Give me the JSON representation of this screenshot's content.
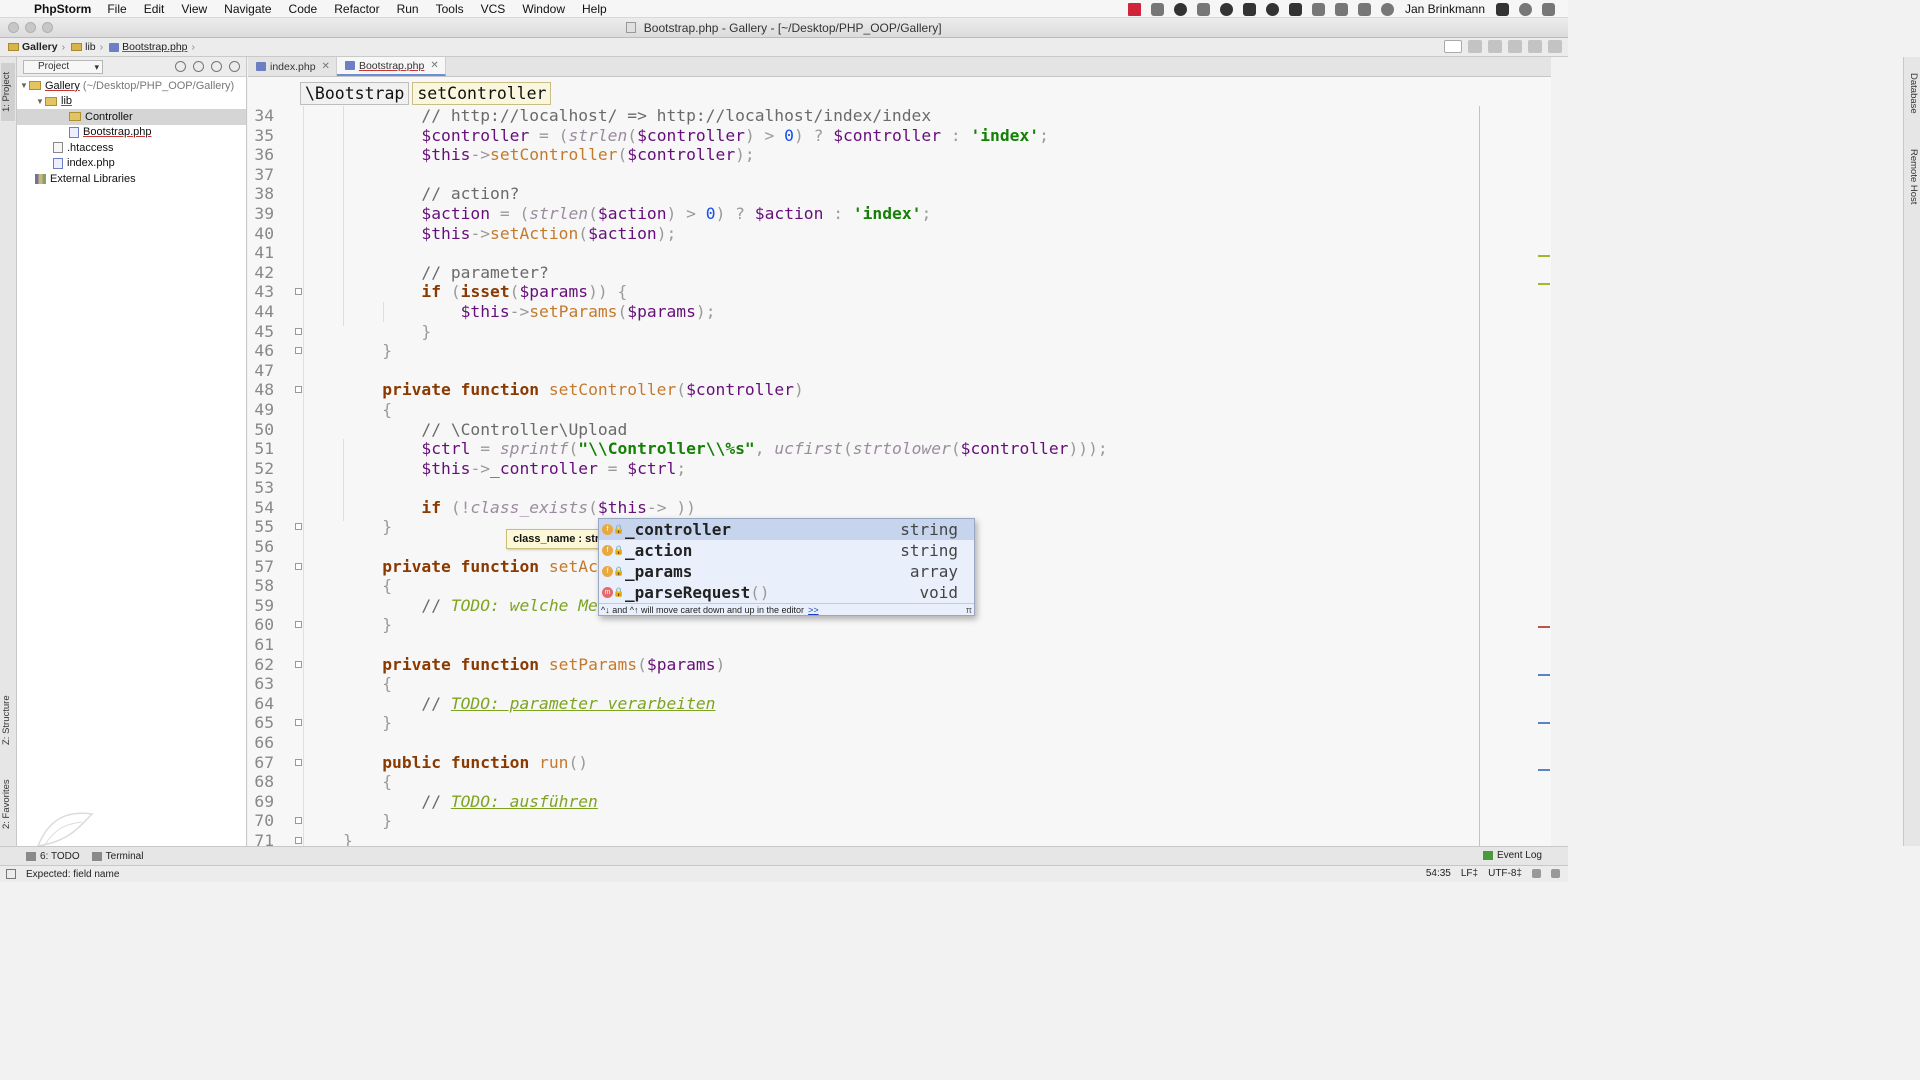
{
  "menubar": {
    "apple": "",
    "app_name": "PhpStorm",
    "items": [
      "File",
      "Edit",
      "View",
      "Navigate",
      "Code",
      "Refactor",
      "Run",
      "Tools",
      "VCS",
      "Window",
      "Help"
    ],
    "user": "Jan Brinkmann"
  },
  "window": {
    "title": "Bootstrap.php - Gallery - [~/Desktop/PHP_OOP/Gallery]"
  },
  "navbar": {
    "crumbs": [
      "Gallery",
      "lib",
      "Bootstrap.php"
    ]
  },
  "left_stripe": {
    "project_tab": "1: Project",
    "structure_tab": "Z: Structure",
    "favorites_tab": "2: Favorites"
  },
  "right_stripe": {
    "database_tab": "Database",
    "remote_host_tab": "Remote Host"
  },
  "project_panel": {
    "view_label": "Project",
    "tree": {
      "root": "Gallery",
      "root_path": "(~/Desktop/PHP_OOP/Gallery)",
      "lib": "lib",
      "controller": "Controller",
      "bootstrap": "Bootstrap.php",
      "htaccess": ".htaccess",
      "index": "index.php",
      "external": "External Libraries"
    }
  },
  "editor_tabs": [
    {
      "label": "index.php",
      "active": false
    },
    {
      "label": "Bootstrap.php",
      "active": true
    }
  ],
  "editor": {
    "breadcrumb": [
      "\\Bootstrap",
      "setController"
    ],
    "param_hint": "class_name : str",
    "lines": [
      {
        "n": "34",
        "segs": [
          [
            "cm",
            "        // http://localhost/ => http://localhost/index/index"
          ]
        ]
      },
      {
        "n": "35",
        "segs": [
          [
            "var",
            "        $controller"
          ],
          [
            "pn",
            " = ("
          ],
          [
            "bfn",
            "strlen"
          ],
          [
            "pn",
            "("
          ],
          [
            "var",
            "$controller"
          ],
          [
            "pn",
            ") > "
          ],
          [
            "num",
            "0"
          ],
          [
            "pn",
            ") ? "
          ],
          [
            "var",
            "$controller"
          ],
          [
            "pn",
            " : "
          ],
          [
            "str",
            "'index'"
          ],
          [
            "pn",
            ";"
          ]
        ]
      },
      {
        "n": "36",
        "segs": [
          [
            "var",
            "        $this"
          ],
          [
            "pn",
            "->"
          ],
          [
            "fn",
            "setController"
          ],
          [
            "pn",
            "("
          ],
          [
            "var",
            "$controller"
          ],
          [
            "pn",
            ");"
          ]
        ]
      },
      {
        "n": "37",
        "segs": []
      },
      {
        "n": "38",
        "segs": [
          [
            "cm",
            "        // action?"
          ]
        ]
      },
      {
        "n": "39",
        "segs": [
          [
            "var",
            "        $action"
          ],
          [
            "pn",
            " = ("
          ],
          [
            "bfn",
            "strlen"
          ],
          [
            "pn",
            "("
          ],
          [
            "var",
            "$action"
          ],
          [
            "pn",
            ") > "
          ],
          [
            "num",
            "0"
          ],
          [
            "pn",
            ") ? "
          ],
          [
            "var",
            "$action"
          ],
          [
            "pn",
            " : "
          ],
          [
            "str",
            "'index'"
          ],
          [
            "pn",
            ";"
          ]
        ]
      },
      {
        "n": "40",
        "segs": [
          [
            "var",
            "        $this"
          ],
          [
            "pn",
            "->"
          ],
          [
            "fn",
            "setAction"
          ],
          [
            "pn",
            "("
          ],
          [
            "var",
            "$action"
          ],
          [
            "pn",
            ");"
          ]
        ]
      },
      {
        "n": "41",
        "segs": []
      },
      {
        "n": "42",
        "segs": [
          [
            "cm",
            "        // parameter?"
          ]
        ]
      },
      {
        "n": "43",
        "segs": [
          [
            "kw",
            "        if"
          ],
          [
            "pn",
            " ("
          ],
          [
            "kw",
            "isset"
          ],
          [
            "pn",
            "("
          ],
          [
            "var",
            "$params"
          ],
          [
            "pn",
            ")) {"
          ]
        ]
      },
      {
        "n": "44",
        "segs": [
          [
            "var",
            "            $this"
          ],
          [
            "pn",
            "->"
          ],
          [
            "fn",
            "setParams"
          ],
          [
            "pn",
            "("
          ],
          [
            "var",
            "$params"
          ],
          [
            "pn",
            ");"
          ]
        ]
      },
      {
        "n": "45",
        "segs": [
          [
            "pn",
            "        }"
          ]
        ]
      },
      {
        "n": "46",
        "segs": [
          [
            "pn",
            "    }"
          ]
        ]
      },
      {
        "n": "47",
        "segs": []
      },
      {
        "n": "48",
        "segs": [
          [
            "kw",
            "    private function "
          ],
          [
            "fn",
            "setController"
          ],
          [
            "pn",
            "("
          ],
          [
            "var",
            "$controller"
          ],
          [
            "pn",
            ")"
          ]
        ]
      },
      {
        "n": "49",
        "segs": [
          [
            "pn",
            "    {"
          ]
        ]
      },
      {
        "n": "50",
        "segs": [
          [
            "cm",
            "        // \\Controller\\Upload"
          ]
        ]
      },
      {
        "n": "51",
        "segs": [
          [
            "var",
            "        $ctrl"
          ],
          [
            "pn",
            " = "
          ],
          [
            "bfn",
            "sprintf"
          ],
          [
            "pn",
            "("
          ],
          [
            "str",
            "\"\\\\Controller\\\\%s\""
          ],
          [
            "pn",
            ", "
          ],
          [
            "bfn",
            "ucfirst"
          ],
          [
            "pn",
            "("
          ],
          [
            "bfn",
            "strtolower"
          ],
          [
            "pn",
            "("
          ],
          [
            "var",
            "$controller"
          ],
          [
            "pn",
            ")));"
          ]
        ]
      },
      {
        "n": "52",
        "segs": [
          [
            "var",
            "        $this"
          ],
          [
            "pn",
            "->"
          ],
          [
            "var",
            "_controller"
          ],
          [
            "pn",
            " = "
          ],
          [
            "var",
            "$ctrl"
          ],
          [
            "pn",
            ";"
          ]
        ]
      },
      {
        "n": "53",
        "segs": []
      },
      {
        "n": "54",
        "segs": [
          [
            "kw",
            "        if"
          ],
          [
            "pn",
            " (!"
          ],
          [
            "bfn",
            "class_exists"
          ],
          [
            "pn",
            "("
          ],
          [
            "var",
            "$this"
          ],
          [
            "pn",
            "-> ))"
          ]
        ]
      },
      {
        "n": "55",
        "segs": [
          [
            "pn",
            "    }"
          ]
        ]
      },
      {
        "n": "56",
        "segs": []
      },
      {
        "n": "57",
        "segs": [
          [
            "kw",
            "    private function "
          ],
          [
            "fn",
            "setAction"
          ]
        ]
      },
      {
        "n": "58",
        "segs": [
          [
            "pn",
            "    {"
          ]
        ]
      },
      {
        "n": "59",
        "segs": [
          [
            "cm",
            "        // "
          ],
          [
            "todo",
            "TODO: welche Method"
          ]
        ]
      },
      {
        "n": "60",
        "segs": [
          [
            "pn",
            "    }"
          ]
        ]
      },
      {
        "n": "61",
        "segs": []
      },
      {
        "n": "62",
        "segs": [
          [
            "kw",
            "    private function "
          ],
          [
            "fn",
            "setParams"
          ],
          [
            "pn",
            "("
          ],
          [
            "var",
            "$params"
          ],
          [
            "pn",
            ")"
          ]
        ]
      },
      {
        "n": "63",
        "segs": [
          [
            "pn",
            "    {"
          ]
        ]
      },
      {
        "n": "64",
        "segs": [
          [
            "cm",
            "        // "
          ],
          [
            "todo",
            "TODO: parameter verarbeiten"
          ]
        ]
      },
      {
        "n": "65",
        "segs": [
          [
            "pn",
            "    }"
          ]
        ]
      },
      {
        "n": "66",
        "segs": []
      },
      {
        "n": "67",
        "segs": [
          [
            "kw",
            "    public function "
          ],
          [
            "fn",
            "run"
          ],
          [
            "pn",
            "()"
          ]
        ]
      },
      {
        "n": "68",
        "segs": [
          [
            "pn",
            "    {"
          ]
        ]
      },
      {
        "n": "69",
        "segs": [
          [
            "cm",
            "        // "
          ],
          [
            "todo",
            "TODO: ausführen"
          ]
        ]
      },
      {
        "n": "70",
        "segs": [
          [
            "pn",
            "    }"
          ]
        ]
      },
      {
        "n": "71",
        "segs": [
          [
            "pn",
            "}"
          ]
        ]
      }
    ]
  },
  "completion": {
    "items": [
      {
        "name": "_controller",
        "type": "string",
        "kind": "field",
        "selected": true
      },
      {
        "name": "_action",
        "type": "string",
        "kind": "field",
        "selected": false
      },
      {
        "name": "_params",
        "type": "array",
        "kind": "field",
        "selected": false
      },
      {
        "name": "_parseRequest",
        "suffix": "()",
        "type": "void",
        "kind": "method",
        "selected": false
      }
    ],
    "footer": "^↓ and ^↑ will move caret down and up in the editor",
    "footer_link": ">>",
    "footer_pi": "π"
  },
  "bottom_tools": {
    "todo": "6: TODO",
    "terminal": "Terminal",
    "event_log": "Event Log"
  },
  "statusbar": {
    "message": "Expected: field name",
    "position": "54:35",
    "line_sep": "LF‡",
    "encoding": "UTF-8‡"
  },
  "colors": {
    "editor_bg": "#f7f7f7",
    "selection": "#c6d4ee",
    "todo": "#7ea321",
    "keyword": "#8a3900"
  }
}
